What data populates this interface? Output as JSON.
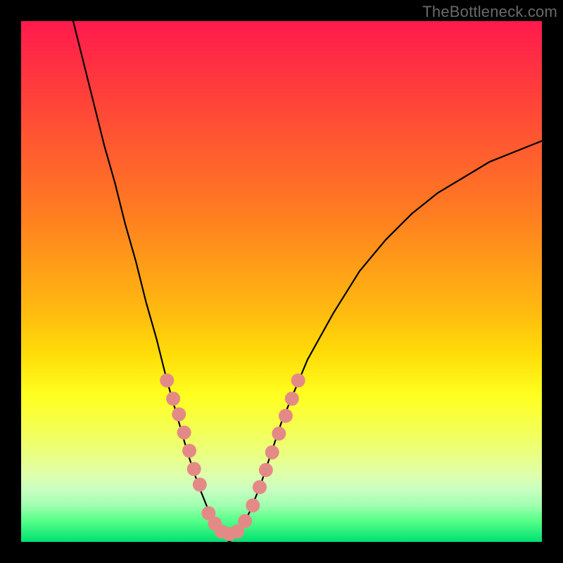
{
  "watermark": {
    "text": "TheBottleneck.com"
  },
  "colors": {
    "background": "#000000",
    "curve": "#000000",
    "dots": "#e48a86",
    "gradient_top": "#ff1a4d",
    "gradient_bottom": "#00e070"
  },
  "chart_data": {
    "type": "line",
    "title": "",
    "xlabel": "",
    "ylabel": "",
    "x_range": [
      0,
      100
    ],
    "y_range": [
      0,
      100
    ],
    "legend": false,
    "grid": false,
    "series": [
      {
        "name": "bottleneck-curve",
        "x": [
          10,
          12,
          14,
          16,
          18,
          20,
          22,
          24,
          26,
          28,
          30,
          32,
          34,
          36,
          38,
          40,
          42,
          44,
          46,
          48,
          50,
          55,
          60,
          65,
          70,
          75,
          80,
          85,
          90,
          95,
          100
        ],
        "y": [
          100,
          92,
          84,
          76,
          69,
          61,
          54,
          46,
          39,
          31,
          24,
          17,
          11,
          6,
          2,
          0,
          2,
          6,
          11,
          17,
          23,
          35,
          44,
          52,
          58,
          63,
          67,
          70,
          73,
          75,
          77
        ],
        "note": "x and y are in percent of plot area; y=0 at bottom of plot, y=100 at top. Curve reaches minimum ~x=40."
      }
    ],
    "annotations": [
      {
        "type": "dot-cluster",
        "name": "highlighted-points",
        "description": "pink/salmon dotted segments overlaid on both sides of the curve near the valley",
        "points_xy": [
          [
            28,
            31
          ],
          [
            29.2,
            27.5
          ],
          [
            30.3,
            24.5
          ],
          [
            31.3,
            21
          ],
          [
            32.3,
            17.5
          ],
          [
            33.2,
            14
          ],
          [
            34.3,
            11
          ],
          [
            36,
            5.5
          ],
          [
            37.2,
            3.5
          ],
          [
            38.5,
            2
          ],
          [
            40,
            1.5
          ],
          [
            41.5,
            2
          ],
          [
            43,
            4
          ],
          [
            44.5,
            7
          ],
          [
            45.8,
            10.5
          ],
          [
            47,
            13.8
          ],
          [
            48.2,
            17.2
          ],
          [
            49.5,
            20.8
          ],
          [
            50.8,
            24.2
          ],
          [
            52,
            27.5
          ],
          [
            53.2,
            31
          ]
        ]
      }
    ],
    "background_gradient": {
      "direction": "top-to-bottom",
      "meaning": "red = high bottleneck, green = low bottleneck",
      "stops": [
        {
          "pos": 0.0,
          "color": "#ff1a4d"
        },
        {
          "pos": 0.5,
          "color": "#ffdd08"
        },
        {
          "pos": 0.8,
          "color": "#ffff50"
        },
        {
          "pos": 1.0,
          "color": "#00e070"
        }
      ]
    }
  }
}
